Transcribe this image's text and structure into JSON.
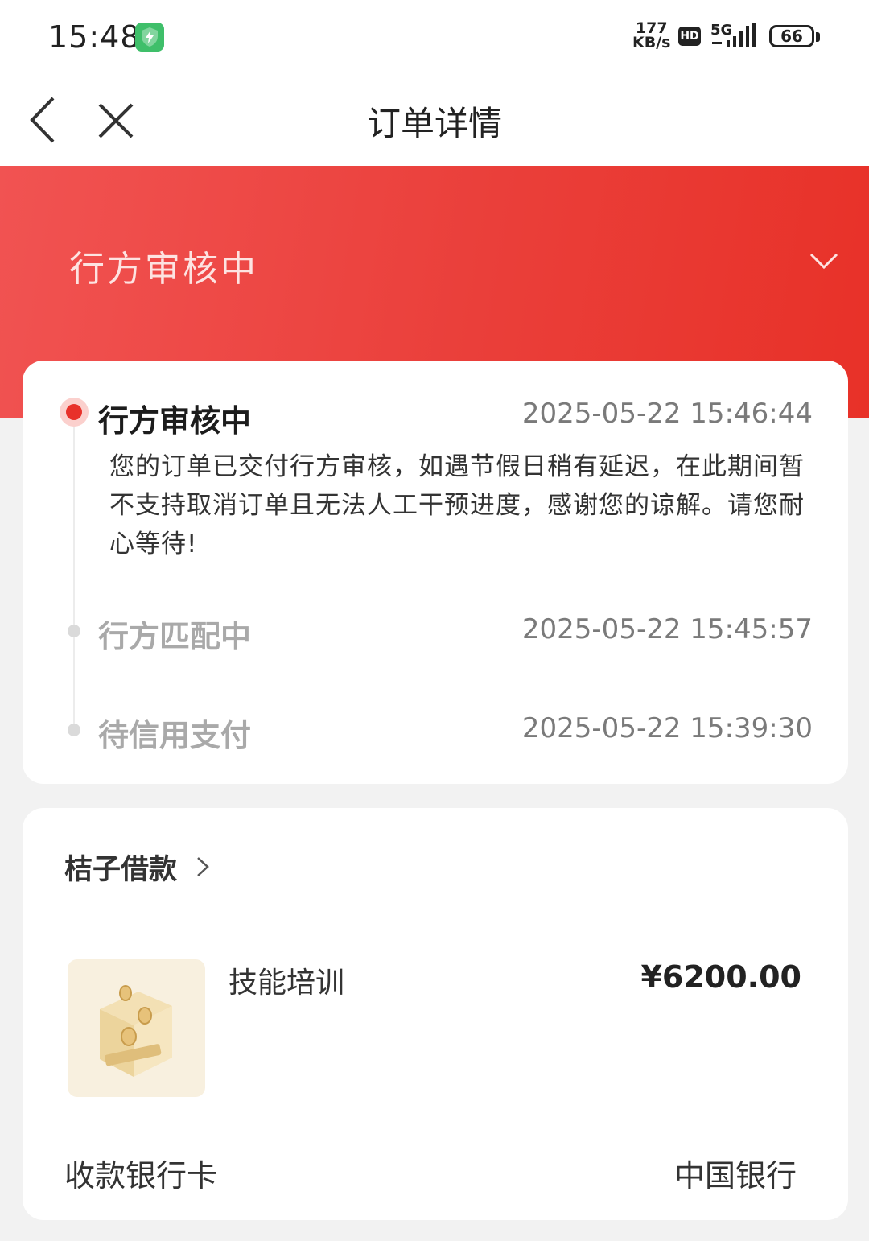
{
  "status_bar": {
    "time": "15:48",
    "net_speed_value": "177",
    "net_speed_unit": "KB/s",
    "hd": "HD",
    "network": "5G",
    "battery": "66"
  },
  "nav": {
    "title": "订单详情",
    "back_icon": "chevron-left-icon",
    "close_icon": "close-icon"
  },
  "banner": {
    "status": "行方审核中",
    "expand_icon": "chevron-down-icon"
  },
  "progress": {
    "steps": [
      {
        "title": "行方审核中",
        "time": "2025-05-22 15:46:44",
        "description": "您的订单已交付行方审核，如遇节假日稍有延迟，在此期间暂不支持取消订单且无法人工干预进度，感谢您的谅解。请您耐心等待!"
      },
      {
        "title": "行方匹配中",
        "time": "2025-05-22 15:45:57"
      },
      {
        "title": "待信用支付",
        "time": "2025-05-22 15:39:30"
      }
    ]
  },
  "order": {
    "merchant": "桔子借款",
    "product": {
      "name": "技能培训",
      "price": "¥6200.00"
    },
    "bank_card_label": "收款银行卡",
    "bank_card_value": "中国银行"
  },
  "colors": {
    "accent": "#e8312a",
    "banner_start": "#f15352",
    "banner_end": "#e83128",
    "muted": "#a9a9a9"
  }
}
